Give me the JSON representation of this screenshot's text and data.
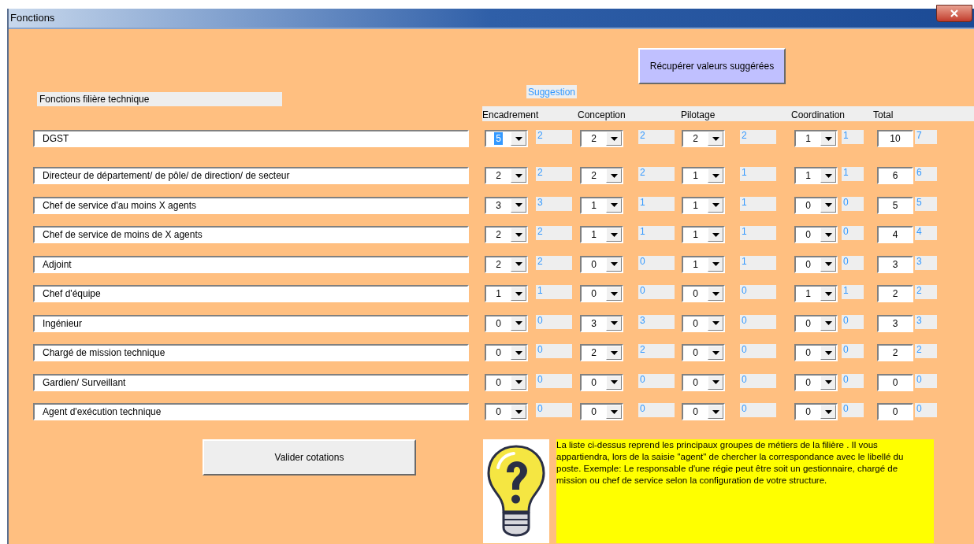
{
  "window": {
    "title": "Fonctions"
  },
  "section_label": "Fonctions filière technique",
  "suggest_button": "Récupérer valeurs suggérées",
  "suggestion_label": "Suggestion",
  "columns": [
    "Encadrement",
    "Conception",
    "Pilotage",
    "Coordination",
    "Total"
  ],
  "rows": [
    {
      "label": "DGST",
      "cells": [
        {
          "value": "5",
          "suggestion": "2",
          "focused": true
        },
        {
          "value": "2",
          "suggestion": "2",
          "focused": false
        },
        {
          "value": "2",
          "suggestion": "2",
          "focused": false
        },
        {
          "value": "1",
          "suggestion": "1",
          "focused": false
        }
      ],
      "total": "10",
      "total_suggestion": "7"
    },
    {
      "label": "Directeur de département/ de pôle/ de direction/ de secteur",
      "cells": [
        {
          "value": "2",
          "suggestion": "2",
          "focused": false
        },
        {
          "value": "2",
          "suggestion": "2",
          "focused": false
        },
        {
          "value": "1",
          "suggestion": "1",
          "focused": false
        },
        {
          "value": "1",
          "suggestion": "1",
          "focused": false
        }
      ],
      "total": "6",
      "total_suggestion": "6"
    },
    {
      "label": "Chef de service d'au moins X agents",
      "cells": [
        {
          "value": "3",
          "suggestion": "3",
          "focused": false
        },
        {
          "value": "1",
          "suggestion": "1",
          "focused": false
        },
        {
          "value": "1",
          "suggestion": "1",
          "focused": false
        },
        {
          "value": "0",
          "suggestion": "0",
          "focused": false
        }
      ],
      "total": "5",
      "total_suggestion": "5"
    },
    {
      "label": "Chef de service de moins de X agents",
      "cells": [
        {
          "value": "2",
          "suggestion": "2",
          "focused": false
        },
        {
          "value": "1",
          "suggestion": "1",
          "focused": false
        },
        {
          "value": "1",
          "suggestion": "1",
          "focused": false
        },
        {
          "value": "0",
          "suggestion": "0",
          "focused": false
        }
      ],
      "total": "4",
      "total_suggestion": "4"
    },
    {
      "label": "Adjoint",
      "cells": [
        {
          "value": "2",
          "suggestion": "2",
          "focused": false
        },
        {
          "value": "0",
          "suggestion": "0",
          "focused": false
        },
        {
          "value": "1",
          "suggestion": "1",
          "focused": false
        },
        {
          "value": "0",
          "suggestion": "0",
          "focused": false
        }
      ],
      "total": "3",
      "total_suggestion": "3"
    },
    {
      "label": "Chef d'équipe",
      "cells": [
        {
          "value": "1",
          "suggestion": "1",
          "focused": false
        },
        {
          "value": "0",
          "suggestion": "0",
          "focused": false
        },
        {
          "value": "0",
          "suggestion": "0",
          "focused": false
        },
        {
          "value": "1",
          "suggestion": "1",
          "focused": false
        }
      ],
      "total": "2",
      "total_suggestion": "2"
    },
    {
      "label": "Ingénieur",
      "cells": [
        {
          "value": "0",
          "suggestion": "0",
          "focused": false
        },
        {
          "value": "3",
          "suggestion": "3",
          "focused": false
        },
        {
          "value": "0",
          "suggestion": "0",
          "focused": false
        },
        {
          "value": "0",
          "suggestion": "0",
          "focused": false
        }
      ],
      "total": "3",
      "total_suggestion": "3"
    },
    {
      "label": "Chargé de mission technique",
      "cells": [
        {
          "value": "0",
          "suggestion": "0",
          "focused": false
        },
        {
          "value": "2",
          "suggestion": "2",
          "focused": false
        },
        {
          "value": "0",
          "suggestion": "0",
          "focused": false
        },
        {
          "value": "0",
          "suggestion": "0",
          "focused": false
        }
      ],
      "total": "2",
      "total_suggestion": "2"
    },
    {
      "label": "Gardien/ Surveillant",
      "cells": [
        {
          "value": "0",
          "suggestion": "0",
          "focused": false
        },
        {
          "value": "0",
          "suggestion": "0",
          "focused": false
        },
        {
          "value": "0",
          "suggestion": "0",
          "focused": false
        },
        {
          "value": "0",
          "suggestion": "0",
          "focused": false
        }
      ],
      "total": "0",
      "total_suggestion": "0"
    },
    {
      "label": "Agent d'exécution technique",
      "cells": [
        {
          "value": "0",
          "suggestion": "0",
          "focused": false
        },
        {
          "value": "0",
          "suggestion": "0",
          "focused": false
        },
        {
          "value": "0",
          "suggestion": "0",
          "focused": false
        },
        {
          "value": "0",
          "suggestion": "0",
          "focused": false
        }
      ],
      "total": "0",
      "total_suggestion": "0"
    }
  ],
  "validate_button": "Valider cotations",
  "help_text": "La liste ci-dessus reprend les principaux groupes de métiers de la filière . Il vous appartiendra, lors de la saisie \"agent\" de chercher la correspondance avec le libellé du poste. Exemple: Le responsable d'une régie peut être soit un gestionnaire, chargé de mission ou chef de service selon la configuration de votre structure."
}
